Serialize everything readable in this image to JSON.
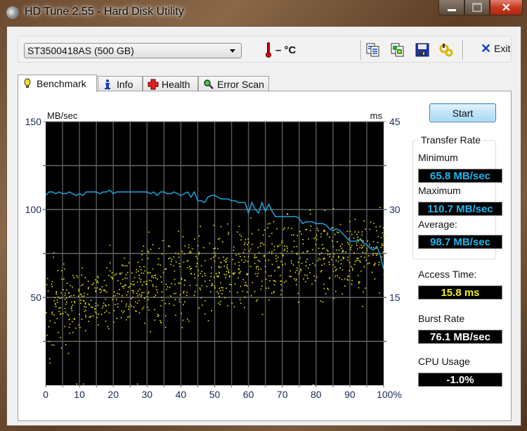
{
  "window": {
    "title": "HD Tune 2.55 - Hard Disk Utility",
    "controls": {
      "minimize": "minimize",
      "maximize": "maximize",
      "close": "close"
    }
  },
  "toolbar": {
    "drive": "ST3500418AS (500 GB)",
    "temperature": "– °C",
    "icons": [
      "copy-text-icon",
      "copy-screenshot-icon",
      "save-icon",
      "options-icon"
    ],
    "exit_label": "Exit"
  },
  "tabs": [
    {
      "label": "Benchmark",
      "icon": "lightbulb-icon",
      "active": true
    },
    {
      "label": "Info",
      "icon": "info-icon",
      "active": false
    },
    {
      "label": "Health",
      "icon": "health-cross-icon",
      "active": false
    },
    {
      "label": "Error Scan",
      "icon": "magnifier-icon",
      "active": false
    }
  ],
  "benchmark": {
    "start_label": "Start",
    "transfer_rate": {
      "title": "Transfer Rate",
      "minimum_label": "Minimum",
      "minimum": "65.8 MB/sec",
      "maximum_label": "Maximum",
      "maximum": "110.7 MB/sec",
      "average_label": "Average:",
      "average": "98.7 MB/sec"
    },
    "access_time_label": "Access Time:",
    "access_time": "15.8 ms",
    "burst_rate_label": "Burst Rate",
    "burst_rate": "76.1 MB/sec",
    "cpu_usage_label": "CPU Usage",
    "cpu_usage": "-1.0%"
  },
  "colors": {
    "transfer_line": "#1aa6e0",
    "access_dots": "#e8e800",
    "value_cyan": "#19b8f0",
    "value_yellow": "#f0f020",
    "value_white": "#ffffff"
  },
  "chart_data": {
    "type": "line",
    "title": "",
    "xlabel": "%",
    "ylabel": "MB/sec",
    "ylabel_right": "ms",
    "xlim": [
      0,
      100
    ],
    "ylim": [
      0,
      150
    ],
    "ylim_right": [
      0,
      45
    ],
    "x_ticks": [
      "0",
      "10",
      "20",
      "30",
      "40",
      "50",
      "60",
      "70",
      "80",
      "90",
      "100%"
    ],
    "y_ticks_left": [
      "50",
      "100",
      "150"
    ],
    "y_ticks_right": [
      "15",
      "30",
      "45"
    ],
    "grid": true,
    "series": [
      {
        "name": "Transfer Rate (MB/sec)",
        "axis": "left",
        "x": [
          0,
          1,
          2,
          3,
          4,
          5,
          6,
          7,
          8,
          9,
          10,
          11,
          12,
          13,
          14,
          15,
          16,
          17,
          18,
          19,
          20,
          21,
          22,
          23,
          24,
          25,
          26,
          27,
          28,
          29,
          30,
          31,
          32,
          33,
          34,
          35,
          36,
          37,
          38,
          39,
          40,
          41,
          42,
          43,
          44,
          45,
          46,
          47,
          48,
          49,
          50,
          51,
          52,
          53,
          54,
          55,
          56,
          57,
          58,
          59,
          60,
          61,
          62,
          63,
          64,
          65,
          66,
          67,
          68,
          69,
          70,
          71,
          72,
          73,
          74,
          75,
          76,
          77,
          78,
          79,
          80,
          81,
          82,
          83,
          84,
          85,
          86,
          87,
          88,
          89,
          90,
          91,
          92,
          93,
          94,
          95,
          96,
          97,
          98,
          99,
          100
        ],
        "values": [
          108,
          110,
          110,
          109,
          110,
          109,
          109,
          110,
          109,
          108,
          109,
          108,
          110,
          110,
          110,
          110,
          109,
          110,
          110,
          111,
          109,
          110,
          110,
          110,
          110,
          110,
          110,
          110,
          110,
          110,
          110,
          109,
          110,
          108,
          110,
          110,
          109,
          109,
          110,
          109,
          108,
          109,
          110,
          107,
          110,
          105,
          105,
          104,
          107,
          108,
          108,
          107,
          106,
          106,
          106,
          105,
          105,
          104,
          104,
          104,
          98,
          104,
          100,
          98,
          104,
          99,
          103,
          99,
          96,
          96,
          96,
          96,
          96,
          96,
          96,
          95,
          92,
          93,
          93,
          93,
          92,
          92,
          92,
          91,
          89,
          88,
          89,
          88,
          86,
          84,
          82,
          82,
          82,
          83,
          81,
          80,
          78,
          77,
          79,
          74,
          66
        ]
      },
      {
        "name": "Access Time (ms)",
        "axis": "right",
        "type": "scatter",
        "description": "approx. 1000 random access samples; spread rises from ~5–20 ms near 0% to ~17–27 ms near 90–100%",
        "trend_low": [
          [
            0,
            5
          ],
          [
            10,
            10
          ],
          [
            20,
            11
          ],
          [
            30,
            12
          ],
          [
            40,
            13
          ],
          [
            50,
            14
          ],
          [
            60,
            15
          ],
          [
            70,
            15
          ],
          [
            80,
            16
          ],
          [
            90,
            17
          ],
          [
            100,
            17
          ]
        ],
        "trend_high": [
          [
            0,
            18
          ],
          [
            10,
            19
          ],
          [
            20,
            21
          ],
          [
            30,
            23
          ],
          [
            40,
            24
          ],
          [
            50,
            25
          ],
          [
            60,
            26
          ],
          [
            70,
            27
          ],
          [
            80,
            27
          ],
          [
            90,
            28
          ],
          [
            100,
            28
          ]
        ]
      }
    ]
  }
}
